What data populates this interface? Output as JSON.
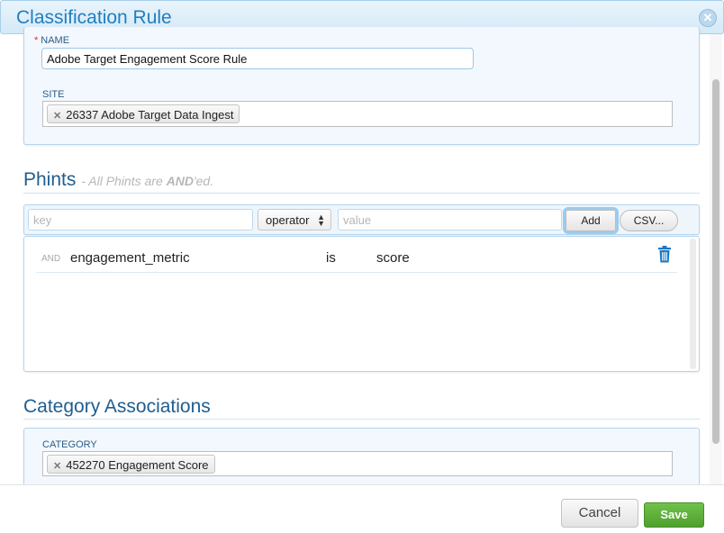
{
  "dialog": {
    "title": "Classification Rule",
    "close_icon": "close-circle-icon"
  },
  "rule_form": {
    "name_label": "NAME",
    "name_value": "Adobe Target Engagement Score Rule",
    "site_label": "SITE",
    "site_token": "26337 Adobe Target Data Ingest"
  },
  "phints": {
    "title": "Phints",
    "hint_prefix": "- All Phints are ",
    "hint_bold": "AND",
    "hint_suffix": "'ed.",
    "key_placeholder": "key",
    "operator_label": "operator",
    "value_placeholder": "value",
    "add_label": "Add",
    "csv_label": "CSV...",
    "rows": [
      {
        "conjunction": "AND",
        "key": "engagement_metric",
        "operator": "is",
        "value": "score"
      }
    ]
  },
  "categories": {
    "title": "Category Associations",
    "category_label": "CATEGORY",
    "category_token": "452270 Engagement Score"
  },
  "footer": {
    "cancel_label": "Cancel",
    "save_label": "Save"
  },
  "colors": {
    "header_title": "#1f7fc0",
    "section_title": "#1f5e8f",
    "panel_bg": "#f2f8fd",
    "save_button": "#5aad36",
    "trash_icon": "#1c79c3"
  }
}
